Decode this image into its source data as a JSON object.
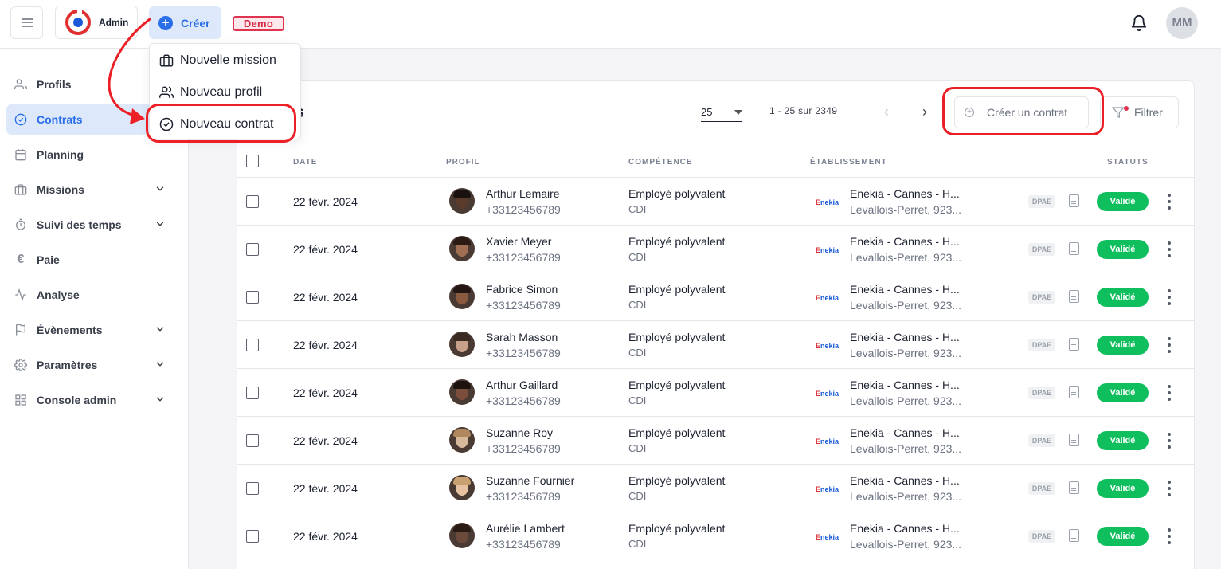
{
  "topbar": {
    "brand_label": "Admin",
    "create_label": "Créer",
    "demo_badge": "Demo",
    "user_initials": "MM"
  },
  "create_menu": {
    "items": [
      {
        "label": "Nouvelle mission",
        "icon": "briefcase-icon"
      },
      {
        "label": "Nouveau profil",
        "icon": "users-icon"
      },
      {
        "label": "Nouveau contrat",
        "icon": "check-circle-icon"
      }
    ]
  },
  "sidebar": {
    "items": [
      {
        "label": "Profils",
        "icon": "users-icon",
        "active": false,
        "expandable": false
      },
      {
        "label": "Contrats",
        "icon": "check-circle-icon",
        "active": true,
        "expandable": false
      },
      {
        "label": "Planning",
        "icon": "calendar-icon",
        "active": false,
        "expandable": false
      },
      {
        "label": "Missions",
        "icon": "briefcase-icon",
        "active": false,
        "expandable": true
      },
      {
        "label": "Suivi des temps",
        "icon": "clock-icon",
        "active": false,
        "expandable": true
      },
      {
        "label": "Paie",
        "icon": "euro-icon",
        "active": false,
        "expandable": false
      },
      {
        "label": "Analyse",
        "icon": "activity-icon",
        "active": false,
        "expandable": false
      },
      {
        "label": "Évènements",
        "icon": "flag-icon",
        "active": false,
        "expandable": true
      },
      {
        "label": "Paramètres",
        "icon": "gear-icon",
        "active": false,
        "expandable": true
      },
      {
        "label": "Console admin",
        "icon": "grid-icon",
        "active": false,
        "expandable": true
      }
    ]
  },
  "contracts": {
    "title_visible": "ats",
    "per_page": "25",
    "range": "1 - 25 sur 2349",
    "create_contract_label": "Créer un contrat",
    "filter_label": "Filtrer",
    "columns": [
      "DATE",
      "PROFIL",
      "COMPÉTENCE",
      "ÉTABLISSEMENT",
      "STATUTS"
    ],
    "rows": [
      {
        "date": "22 févr. 2024",
        "name": "Arthur Lemaire",
        "phone": "+33123456789",
        "competence": "Employé polyvalent",
        "type": "CDI",
        "establishment": "Enekia - Cannes - H...",
        "address": "Levallois-Perret, 923...",
        "dpae": "DPAE",
        "status": "Validé"
      },
      {
        "date": "22 févr. 2024",
        "name": "Xavier Meyer",
        "phone": "+33123456789",
        "competence": "Employé polyvalent",
        "type": "CDI",
        "establishment": "Enekia - Cannes - H...",
        "address": "Levallois-Perret, 923...",
        "dpae": "DPAE",
        "status": "Validé"
      },
      {
        "date": "22 févr. 2024",
        "name": "Fabrice Simon",
        "phone": "+33123456789",
        "competence": "Employé polyvalent",
        "type": "CDI",
        "establishment": "Enekia - Cannes - H...",
        "address": "Levallois-Perret, 923...",
        "dpae": "DPAE",
        "status": "Validé"
      },
      {
        "date": "22 févr. 2024",
        "name": "Sarah Masson",
        "phone": "+33123456789",
        "competence": "Employé polyvalent",
        "type": "CDI",
        "establishment": "Enekia - Cannes - H...",
        "address": "Levallois-Perret, 923...",
        "dpae": "DPAE",
        "status": "Validé"
      },
      {
        "date": "22 févr. 2024",
        "name": "Arthur Gaillard",
        "phone": "+33123456789",
        "competence": "Employé polyvalent",
        "type": "CDI",
        "establishment": "Enekia - Cannes - H...",
        "address": "Levallois-Perret, 923...",
        "dpae": "DPAE",
        "status": "Validé"
      },
      {
        "date": "22 févr. 2024",
        "name": "Suzanne Roy",
        "phone": "+33123456789",
        "competence": "Employé polyvalent",
        "type": "CDI",
        "establishment": "Enekia - Cannes - H...",
        "address": "Levallois-Perret, 923...",
        "dpae": "DPAE",
        "status": "Validé"
      },
      {
        "date": "22 févr. 2024",
        "name": "Suzanne Fournier",
        "phone": "+33123456789",
        "competence": "Employé polyvalent",
        "type": "CDI",
        "establishment": "Enekia - Cannes - H...",
        "address": "Levallois-Perret, 923...",
        "dpae": "DPAE",
        "status": "Validé"
      },
      {
        "date": "22 févr. 2024",
        "name": "Aurélie Lambert",
        "phone": "+33123456789",
        "competence": "Employé polyvalent",
        "type": "CDI",
        "establishment": "Enekia - Cannes - H...",
        "address": "Levallois-Perret, 923...",
        "dpae": "DPAE",
        "status": "Validé"
      }
    ]
  },
  "colors": {
    "accent": "#2a6ee8",
    "accent_bg": "#dde9fb",
    "status_valid": "#0fbf5e",
    "highlight": "#ec1f26",
    "demo": "#e0334f"
  }
}
